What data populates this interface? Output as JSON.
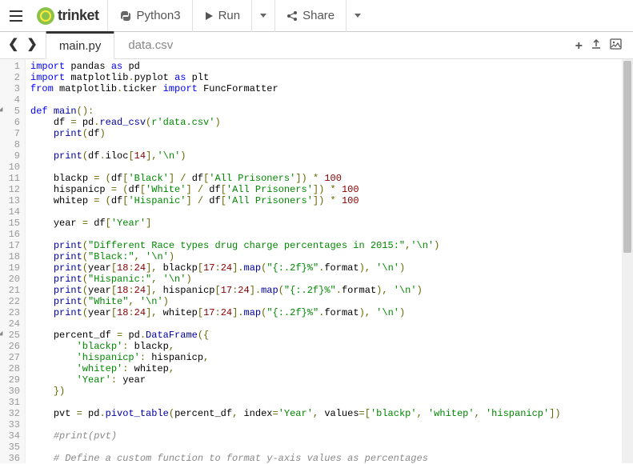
{
  "brand": "trinket",
  "toolbar": {
    "language": "Python3",
    "run": "Run",
    "share": "Share"
  },
  "tabs": {
    "active": "main.py",
    "other": "data.csv"
  },
  "code_lines": [
    {
      "n": 1,
      "html": "<span class='kw'>import</span> <span class='id'>pandas</span> <span class='kw'>as</span> <span class='id'>pd</span>"
    },
    {
      "n": 2,
      "html": "<span class='kw'>import</span> <span class='id'>matplotlib</span><span class='op'>.</span><span class='id'>pyplot</span> <span class='kw'>as</span> <span class='id'>plt</span>"
    },
    {
      "n": 3,
      "html": "<span class='kw'>from</span> <span class='id'>matplotlib</span><span class='op'>.</span><span class='id'>ticker</span> <span class='kw'>import</span> <span class='id'>FuncFormatter</span>"
    },
    {
      "n": 4,
      "html": ""
    },
    {
      "n": 5,
      "fold": true,
      "html": "<span class='kw'>def</span> <span class='fn'>main</span><span class='op'>():</span>"
    },
    {
      "n": 6,
      "html": "    <span class='id'>df</span> <span class='op'>=</span> <span class='id'>pd</span><span class='op'>.</span><span class='fn'>read_csv</span><span class='op'>(</span><span class='str'>r'data.csv'</span><span class='op'>)</span>"
    },
    {
      "n": 7,
      "html": "    <span class='fn'>print</span><span class='op'>(</span><span class='id'>df</span><span class='op'>)</span>"
    },
    {
      "n": 8,
      "html": ""
    },
    {
      "n": 9,
      "html": "    <span class='fn'>print</span><span class='op'>(</span><span class='id'>df</span><span class='op'>.</span><span class='id'>iloc</span><span class='op'>[</span><span class='num'>14</span><span class='op'>],</span><span class='str'>'\\n'</span><span class='op'>)</span>"
    },
    {
      "n": 10,
      "html": ""
    },
    {
      "n": 11,
      "html": "    <span class='id'>blackp</span> <span class='op'>=</span> <span class='op'>(</span><span class='id'>df</span><span class='op'>[</span><span class='str'>'Black'</span><span class='op'>]</span> <span class='op'>/</span> <span class='id'>df</span><span class='op'>[</span><span class='str'>'All Prisoners'</span><span class='op'>])</span> <span class='op'>*</span> <span class='num'>100</span>"
    },
    {
      "n": 12,
      "html": "    <span class='id'>hispanicp</span> <span class='op'>=</span> <span class='op'>(</span><span class='id'>df</span><span class='op'>[</span><span class='str'>'White'</span><span class='op'>]</span> <span class='op'>/</span> <span class='id'>df</span><span class='op'>[</span><span class='str'>'All Prisoners'</span><span class='op'>])</span> <span class='op'>*</span> <span class='num'>100</span>"
    },
    {
      "n": 13,
      "html": "    <span class='id'>whitep</span> <span class='op'>=</span> <span class='op'>(</span><span class='id'>df</span><span class='op'>[</span><span class='str'>'Hispanic'</span><span class='op'>]</span> <span class='op'>/</span> <span class='id'>df</span><span class='op'>[</span><span class='str'>'All Prisoners'</span><span class='op'>])</span> <span class='op'>*</span> <span class='num'>100</span>"
    },
    {
      "n": 14,
      "html": ""
    },
    {
      "n": 15,
      "html": "    <span class='id'>year</span> <span class='op'>=</span> <span class='id'>df</span><span class='op'>[</span><span class='str'>'Year'</span><span class='op'>]</span>"
    },
    {
      "n": 16,
      "html": ""
    },
    {
      "n": 17,
      "html": "    <span class='fn'>print</span><span class='op'>(</span><span class='str'>\"Different Race types drug charge percentages in 2015:\"</span><span class='op'>,</span><span class='str'>'\\n'</span><span class='op'>)</span>"
    },
    {
      "n": 18,
      "html": "    <span class='fn'>print</span><span class='op'>(</span><span class='str'>\"Black:\"</span><span class='op'>,</span> <span class='str'>'\\n'</span><span class='op'>)</span>"
    },
    {
      "n": 19,
      "html": "    <span class='fn'>print</span><span class='op'>(</span><span class='id'>year</span><span class='op'>[</span><span class='num'>18</span><span class='op'>:</span><span class='num'>24</span><span class='op'>],</span> <span class='id'>blackp</span><span class='op'>[</span><span class='num'>17</span><span class='op'>:</span><span class='num'>24</span><span class='op'>].</span><span class='fn'>map</span><span class='op'>(</span><span class='str'>\"{:.2f}%\"</span><span class='op'>.</span><span class='id'>format</span><span class='op'>),</span> <span class='str'>'\\n'</span><span class='op'>)</span>"
    },
    {
      "n": 20,
      "html": "    <span class='fn'>print</span><span class='op'>(</span><span class='str'>\"Hispanic:\"</span><span class='op'>,</span> <span class='str'>'\\n'</span><span class='op'>)</span>"
    },
    {
      "n": 21,
      "html": "    <span class='fn'>print</span><span class='op'>(</span><span class='id'>year</span><span class='op'>[</span><span class='num'>18</span><span class='op'>:</span><span class='num'>24</span><span class='op'>],</span> <span class='id'>hispanicp</span><span class='op'>[</span><span class='num'>17</span><span class='op'>:</span><span class='num'>24</span><span class='op'>].</span><span class='fn'>map</span><span class='op'>(</span><span class='str'>\"{:.2f}%\"</span><span class='op'>.</span><span class='id'>format</span><span class='op'>),</span> <span class='str'>'\\n'</span><span class='op'>)</span>"
    },
    {
      "n": 22,
      "html": "    <span class='fn'>print</span><span class='op'>(</span><span class='str'>\"White\"</span><span class='op'>,</span> <span class='str'>'\\n'</span><span class='op'>)</span>"
    },
    {
      "n": 23,
      "html": "    <span class='fn'>print</span><span class='op'>(</span><span class='id'>year</span><span class='op'>[</span><span class='num'>18</span><span class='op'>:</span><span class='num'>24</span><span class='op'>],</span> <span class='id'>whitep</span><span class='op'>[</span><span class='num'>17</span><span class='op'>:</span><span class='num'>24</span><span class='op'>].</span><span class='fn'>map</span><span class='op'>(</span><span class='str'>\"{:.2f}%\"</span><span class='op'>.</span><span class='id'>format</span><span class='op'>),</span> <span class='str'>'\\n'</span><span class='op'>)</span>"
    },
    {
      "n": 24,
      "html": ""
    },
    {
      "n": 25,
      "fold": true,
      "html": "    <span class='id'>percent_df</span> <span class='op'>=</span> <span class='id'>pd</span><span class='op'>.</span><span class='fn'>DataFrame</span><span class='op'>({</span>"
    },
    {
      "n": 26,
      "html": "        <span class='str'>'blackp'</span><span class='op'>:</span> <span class='id'>blackp</span><span class='op'>,</span>"
    },
    {
      "n": 27,
      "html": "        <span class='str'>'hispanicp'</span><span class='op'>:</span> <span class='id'>hispanicp</span><span class='op'>,</span>"
    },
    {
      "n": 28,
      "html": "        <span class='str'>'whitep'</span><span class='op'>:</span> <span class='id'>whitep</span><span class='op'>,</span>"
    },
    {
      "n": 29,
      "html": "        <span class='str'>'Year'</span><span class='op'>:</span> <span class='id'>year</span>"
    },
    {
      "n": 30,
      "html": "    <span class='op'>})</span>"
    },
    {
      "n": 31,
      "html": ""
    },
    {
      "n": 32,
      "html": "    <span class='id'>pvt</span> <span class='op'>=</span> <span class='id'>pd</span><span class='op'>.</span><span class='fn'>pivot_table</span><span class='op'>(</span><span class='id'>percent_df</span><span class='op'>,</span> <span class='id'>index</span><span class='op'>=</span><span class='str'>'Year'</span><span class='op'>,</span> <span class='id'>values</span><span class='op'>=[</span><span class='str'>'blackp'</span><span class='op'>,</span> <span class='str'>'whitep'</span><span class='op'>,</span> <span class='str'>'hispanicp'</span><span class='op'>])</span>"
    },
    {
      "n": 33,
      "html": ""
    },
    {
      "n": 34,
      "html": "    <span class='com'>#print(pvt)</span>"
    },
    {
      "n": 35,
      "html": ""
    },
    {
      "n": 36,
      "html": "    <span class='com'># Define a custom function to format y-axis values as percentages</span>"
    }
  ]
}
